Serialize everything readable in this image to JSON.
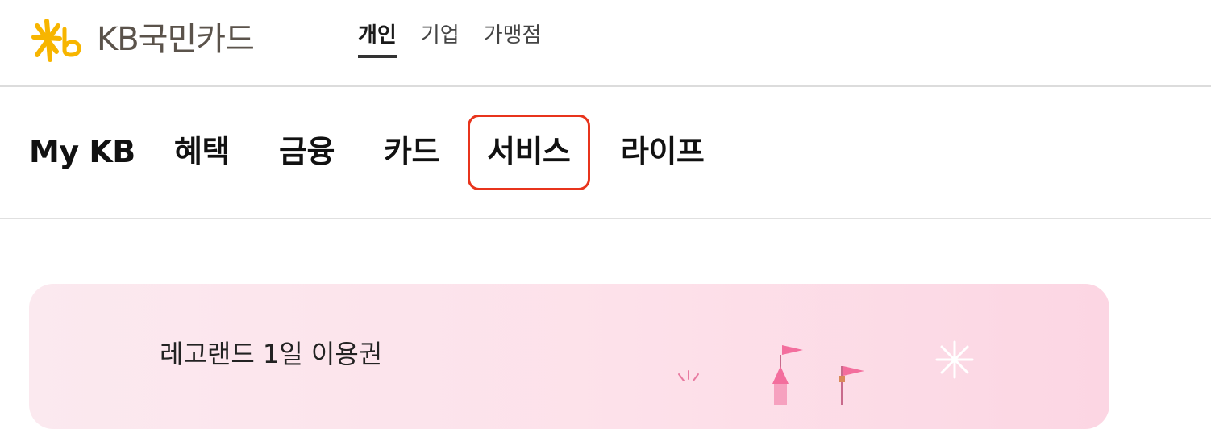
{
  "brand": {
    "name": "KB국민카드",
    "colors": {
      "star": "#f7b500",
      "text": "#5b534b",
      "highlight": "#e8341c"
    }
  },
  "segment_tabs": [
    {
      "label": "개인",
      "active": true
    },
    {
      "label": "기업",
      "active": false
    },
    {
      "label": "가맹점",
      "active": false
    }
  ],
  "gnb": {
    "items": [
      {
        "label": "My KB"
      },
      {
        "label": "혜택"
      },
      {
        "label": "금융"
      },
      {
        "label": "카드"
      },
      {
        "label": "서비스",
        "highlighted": true
      },
      {
        "label": "라이프"
      }
    ]
  },
  "banner": {
    "title": "레고랜드 1일 이용권",
    "illustration": "castle-fireworks-illustration"
  }
}
